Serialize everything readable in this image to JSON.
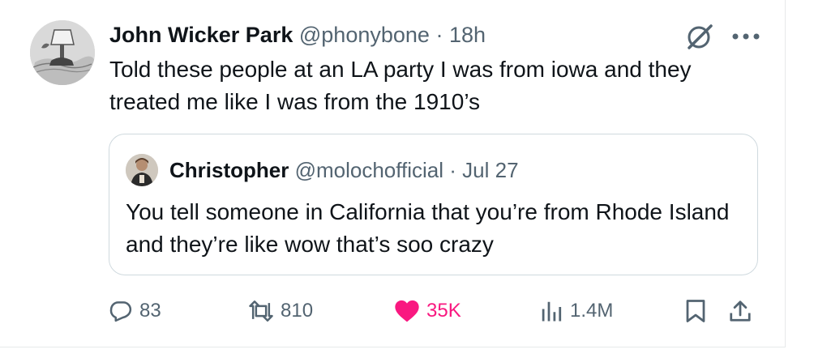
{
  "tweet": {
    "author_name": "John Wicker Park",
    "handle": "@phonybone",
    "separator": "·",
    "time": "18h",
    "text": "Told these people at an LA party I was from iowa and they treated me like I was from the 1910’s"
  },
  "quoted_tweet": {
    "author_name": "Christopher",
    "handle": "@molochofficial",
    "separator": "·",
    "time": "Jul 27",
    "text": "You tell someone in California that you’re from Rhode Island and they’re like wow that’s soo crazy"
  },
  "actions": {
    "replies": "83",
    "reposts": "810",
    "likes": "35K",
    "views": "1.4M"
  },
  "icons": {
    "header": [
      "grok-icon",
      "more-icon"
    ],
    "actions": [
      "reply-icon",
      "repost-icon",
      "like-icon",
      "views-icon",
      "bookmark-icon",
      "share-icon"
    ]
  },
  "colors": {
    "text_primary": "#0f1419",
    "text_secondary": "#536471",
    "like_active": "#f91880",
    "border": "#cfd9de"
  }
}
